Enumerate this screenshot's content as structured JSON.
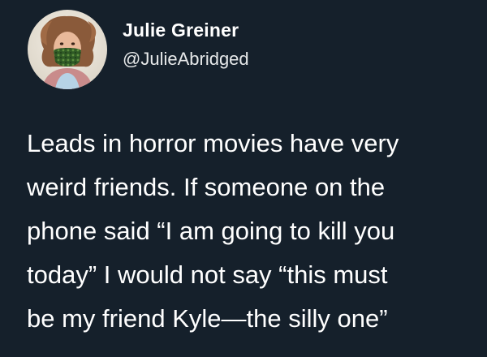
{
  "author": {
    "display_name": "Julie Greiner",
    "handle": "@JulieAbridged",
    "avatar_icon": "profile-photo-masked-woman"
  },
  "tweet": {
    "lines": [
      "Leads in horror movies have very",
      "weird friends. If someone on the",
      "phone said “I am going to kill you",
      "today” I would not say “this must",
      "be my friend Kyle—the silly one”"
    ]
  },
  "colors": {
    "background": "#15202b",
    "text": "#ffffff",
    "mask_green": "#3c6a2e"
  }
}
